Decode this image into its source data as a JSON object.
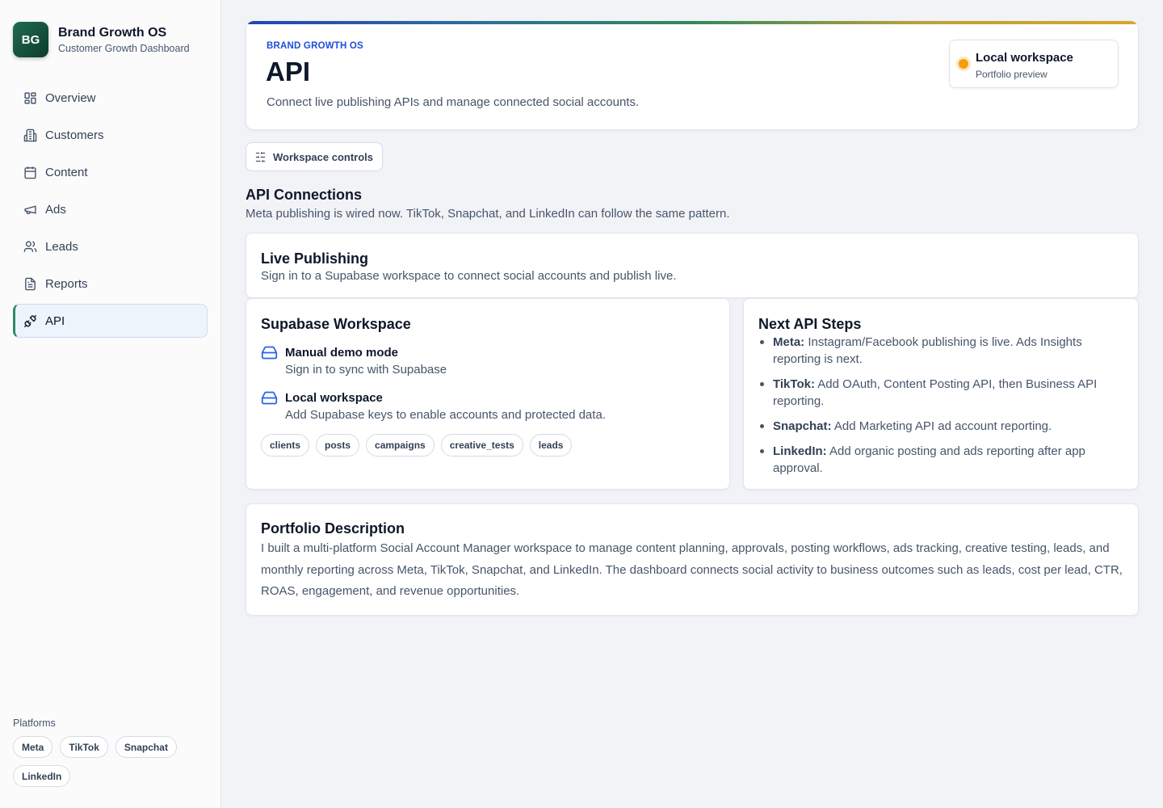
{
  "brand": {
    "initials": "BG",
    "name": "Brand Growth OS",
    "subtitle": "Customer Growth Dashboard"
  },
  "nav": {
    "items": [
      {
        "label": "Overview",
        "icon": "grid-icon"
      },
      {
        "label": "Customers",
        "icon": "building-icon"
      },
      {
        "label": "Content",
        "icon": "calendar-icon"
      },
      {
        "label": "Ads",
        "icon": "megaphone-icon"
      },
      {
        "label": "Leads",
        "icon": "users-icon"
      },
      {
        "label": "Reports",
        "icon": "file-text-icon"
      },
      {
        "label": "API",
        "icon": "plug-icon",
        "active": true
      }
    ]
  },
  "platforms": {
    "title": "Platforms",
    "items": [
      "Meta",
      "TikTok",
      "Snapchat",
      "LinkedIn"
    ]
  },
  "header": {
    "eyebrow": "BRAND GROWTH OS",
    "title": "API",
    "description": "Connect live publishing APIs and manage connected social accounts.",
    "workspace": {
      "title": "Local workspace",
      "subtitle": "Portfolio preview",
      "status_color": "#f59e0b"
    }
  },
  "controls": {
    "label": "Workspace controls",
    "icon": "sliders-icon"
  },
  "section": {
    "title": "API Connections",
    "subtitle": "Meta publishing is wired now. TikTok, Snapchat, and LinkedIn can follow the same pattern."
  },
  "live_publishing": {
    "title": "Live Publishing",
    "subtitle": "Sign in to a Supabase workspace to connect social accounts and publish live."
  },
  "supabase": {
    "title": "Supabase Workspace",
    "items": [
      {
        "title": "Manual demo mode",
        "subtitle": "Sign in to sync with Supabase",
        "icon": "database-icon"
      },
      {
        "title": "Local workspace",
        "subtitle": "Add Supabase keys to enable accounts and protected data.",
        "icon": "database-icon"
      }
    ],
    "tables": [
      "clients",
      "posts",
      "campaigns",
      "creative_tests",
      "leads"
    ]
  },
  "next_steps": {
    "title": "Next API Steps",
    "items": [
      {
        "platform": "Meta:",
        "text": "Instagram/Facebook publishing is live. Ads Insights reporting is next."
      },
      {
        "platform": "TikTok:",
        "text": "Add OAuth, Content Posting API, then Business API reporting."
      },
      {
        "platform": "Snapchat:",
        "text": "Add Marketing API ad account reporting."
      },
      {
        "platform": "LinkedIn:",
        "text": "Add organic posting and ads reporting after app approval."
      }
    ]
  },
  "portfolio": {
    "title": "Portfolio Description",
    "body": "I built a multi-platform Social Account Manager workspace to manage content planning, approvals, posting workflows, ads tracking, creative testing, leads, and monthly reporting across Meta, TikTok, Snapchat, and LinkedIn. The dashboard connects social activity to business outcomes such as leads, cost per lead, CTR, ROAS, engagement, and revenue opportunities."
  },
  "colors": {
    "accent": "#1d4ed8",
    "brand": "#1f6b4f",
    "active_border": "#2d8a6a",
    "warning": "#f59e0b"
  }
}
